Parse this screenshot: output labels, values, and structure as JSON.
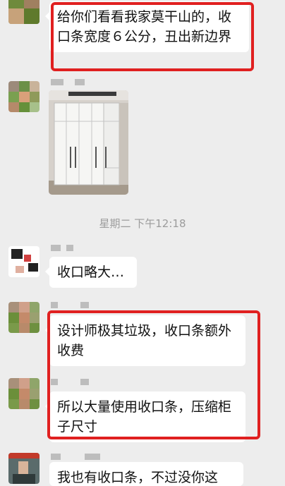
{
  "messages": [
    {
      "text": "给你们看看我家莫干山的，收口条宽度６公分，丑出新边界"
    },
    {
      "image_alt": "white wardrobe photo"
    },
    {
      "text": "收口略大…"
    },
    {
      "text": "设计师极其垃圾，收口条额外收费"
    },
    {
      "text": "所以大量使用收口条，压缩柜子尺寸"
    },
    {
      "text": "我也有收口条，不过没你这"
    }
  ],
  "timestamp": "星期二 下午12:18",
  "colors": {
    "background": "#ededed",
    "bubble": "#ffffff",
    "highlight": "#e02020"
  }
}
